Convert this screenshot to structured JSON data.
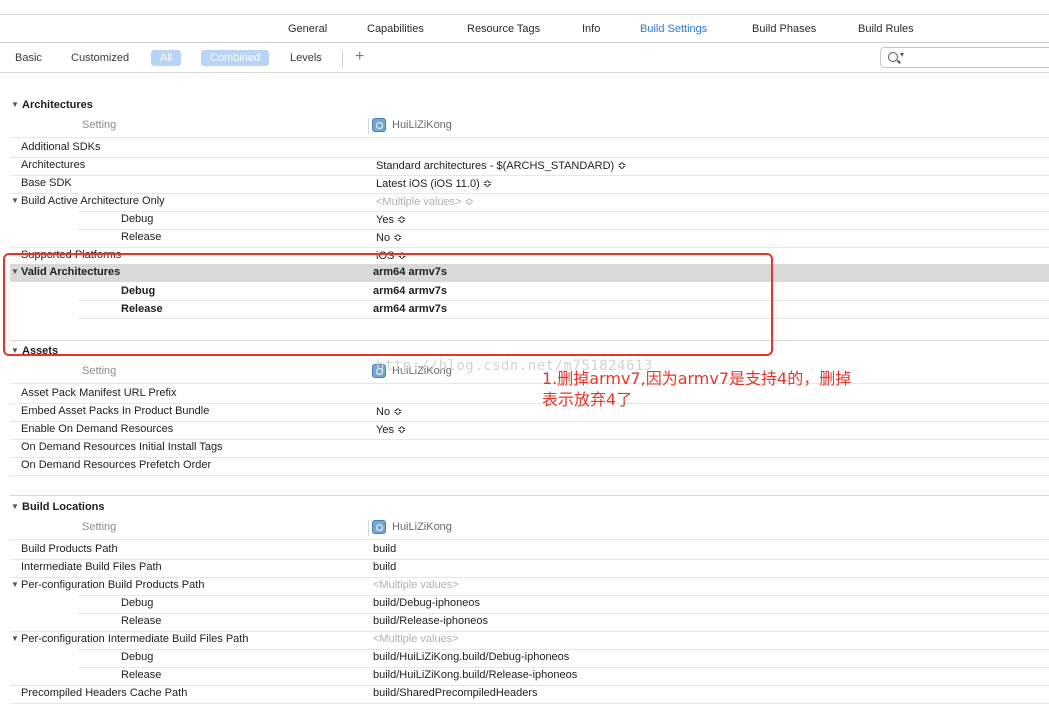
{
  "tabs": [
    {
      "label": "General"
    },
    {
      "label": "Capabilities"
    },
    {
      "label": "Resource Tags"
    },
    {
      "label": "Info"
    },
    {
      "label": "Build Settings"
    },
    {
      "label": "Build Phases"
    },
    {
      "label": "Build Rules"
    }
  ],
  "filter": {
    "basic": "Basic",
    "customized": "Customized",
    "all": "All",
    "combined": "Combined",
    "levels": "Levels",
    "add": "+",
    "search_placeholder": ""
  },
  "target_name": "HuiLiZiKong",
  "setting_header": "Setting",
  "sections": {
    "architectures": {
      "title": "Architectures",
      "rows": [
        {
          "label": "Additional SDKs",
          "value": ""
        },
        {
          "label": "Architectures",
          "value": "Standard architectures  -  $(ARCHS_STANDARD) ≎"
        },
        {
          "label": "Base SDK",
          "value": "Latest iOS (iOS 11.0) ≎"
        },
        {
          "label": "Build Active Architecture Only",
          "value": "<Multiple values> ≎"
        },
        {
          "label": "Debug",
          "value": "Yes ≎"
        },
        {
          "label": "Release",
          "value": "No ≎"
        },
        {
          "label": "Supported Platforms",
          "value": "iOS ≎"
        },
        {
          "label": "Valid Architectures",
          "value": "arm64 armv7s"
        },
        {
          "label": "Debug",
          "value": "arm64 armv7s"
        },
        {
          "label": "Release",
          "value": "arm64 armv7s"
        }
      ]
    },
    "assets": {
      "title": "Assets",
      "rows": [
        {
          "label": "Asset Pack Manifest URL Prefix",
          "value": ""
        },
        {
          "label": "Embed Asset Packs In Product Bundle",
          "value": "No ≎"
        },
        {
          "label": "Enable On Demand Resources",
          "value": "Yes ≎"
        },
        {
          "label": "On Demand Resources Initial Install Tags",
          "value": ""
        },
        {
          "label": "On Demand Resources Prefetch Order",
          "value": ""
        }
      ]
    },
    "build_locations": {
      "title": "Build Locations",
      "rows": [
        {
          "label": "Build Products Path",
          "value": "build"
        },
        {
          "label": "Intermediate Build Files Path",
          "value": "build"
        },
        {
          "label": "Per-configuration Build Products Path",
          "value": "<Multiple values>"
        },
        {
          "label": "Debug",
          "value": "build/Debug-iphoneos"
        },
        {
          "label": "Release",
          "value": "build/Release-iphoneos"
        },
        {
          "label": "Per-configuration Intermediate Build Files Path",
          "value": "<Multiple values>"
        },
        {
          "label": "Debug",
          "value": "build/HuiLiZiKong.build/Debug-iphoneos"
        },
        {
          "label": "Release",
          "value": "build/HuiLiZiKong.build/Release-iphoneos"
        },
        {
          "label": "Precompiled Headers Cache Path",
          "value": "build/SharedPrecompiledHeaders"
        }
      ]
    }
  },
  "annotation": {
    "line1": "1.删掉armv7,因为armv7是支持4的，删掉",
    "line2": "表示放弃4了"
  },
  "watermark": "http://blog.csdn.net/m751824613",
  "colors": {
    "accent": "#2d7ad6",
    "annotation_red": "#e8352b",
    "highlight_row": "#d9d9d9",
    "pill": "#b7d3f5"
  }
}
